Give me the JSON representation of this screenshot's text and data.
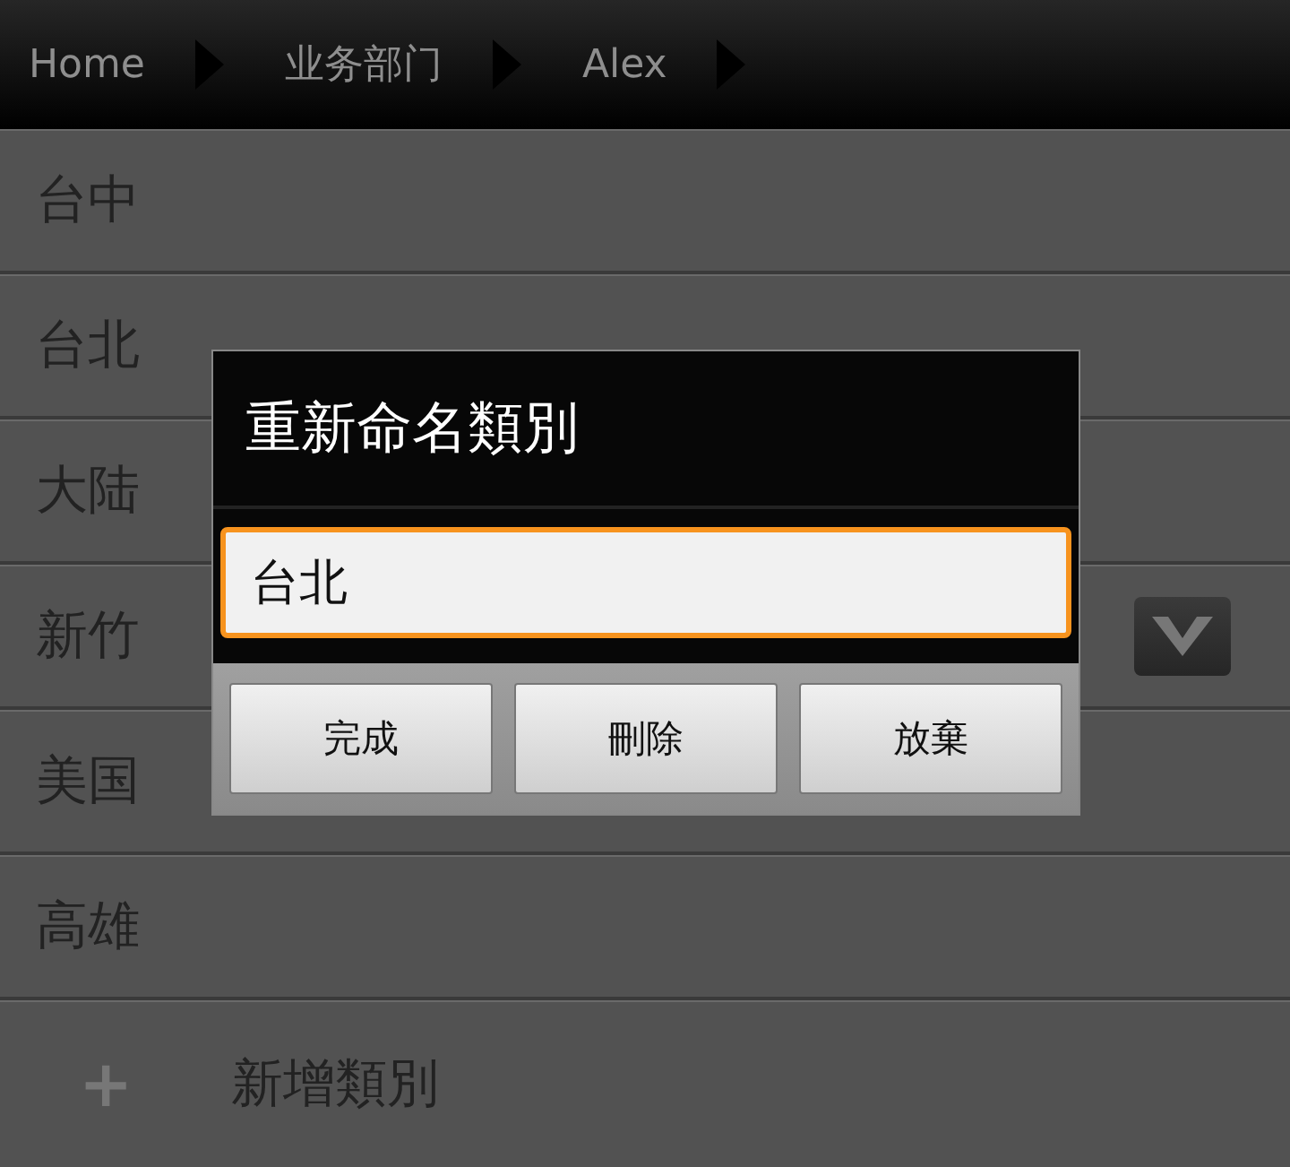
{
  "breadcrumbs": [
    "Home",
    "业务部门",
    "Alex"
  ],
  "categories": [
    {
      "name": "台中",
      "has_menu": false
    },
    {
      "name": "台北",
      "has_menu": false
    },
    {
      "name": "大陆",
      "has_menu": false
    },
    {
      "name": "新竹",
      "has_menu": true
    },
    {
      "name": "美国",
      "has_menu": false
    },
    {
      "name": "高雄",
      "has_menu": false
    }
  ],
  "add_row": {
    "icon": "+",
    "label": "新增類別"
  },
  "dialog": {
    "title": "重新命名類別",
    "value": "台北",
    "buttons": [
      "完成",
      "刪除",
      "放棄"
    ]
  }
}
